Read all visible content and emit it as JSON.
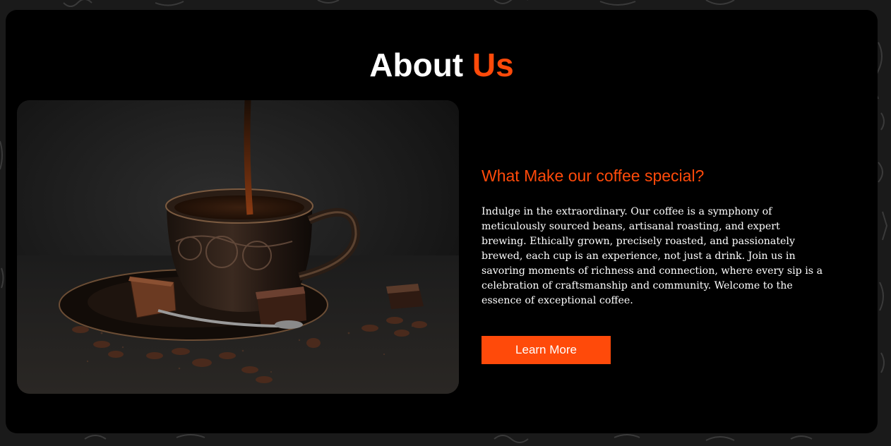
{
  "section": {
    "title_main": "About",
    "title_accent": "Us"
  },
  "about": {
    "heading": "What Make our coffee special?",
    "body": "Indulge in the extraordinary. Our coffee is a symphony of meticulously sourced beans, artisanal roasting, and expert brewing. Ethically grown, precisely roasted, and passionately brewed, each cup is an experience, not just a drink. Join us in savoring moments of richness and connection, where every sip is a celebration of craftsmanship and community. Welcome to the essence of exceptional coffee.",
    "button_label": "Learn More"
  },
  "colors": {
    "accent": "#ff4a0a",
    "card_background": "#000000",
    "page_background": "#1a1a1a",
    "text": "#ffffff"
  },
  "image": {
    "subject": "coffee-cup-with-chocolate-photo"
  }
}
